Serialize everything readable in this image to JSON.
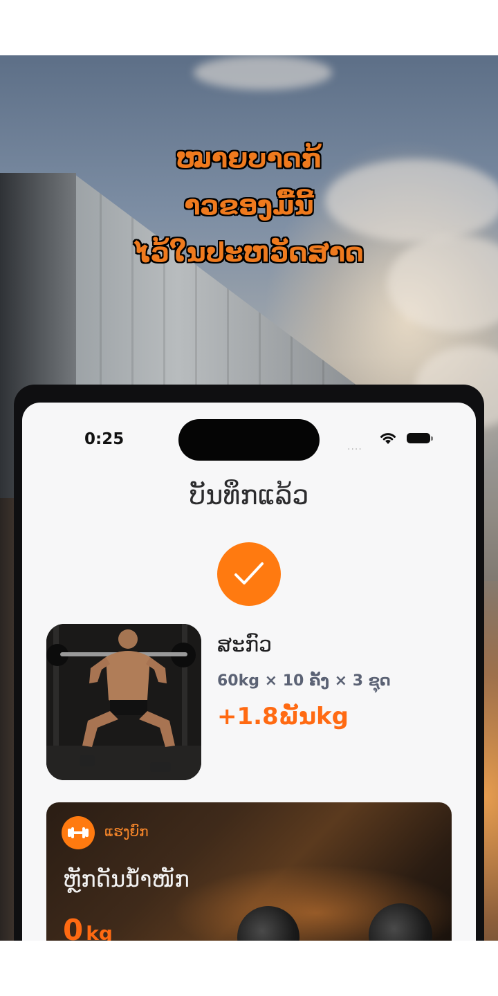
{
  "headline": {
    "lines": [
      "ໝາຍບາດກ້າວຂອງມື້ນີ້",
      "ໄວ້ໃນປະຫວັດສາດ"
    ],
    "line1": "ໝາຍບາດກ້",
    "line2": "າວຂອງມື້ນີ້",
    "line3": "ໄວ້ໃນປະຫວັດສາດ",
    "color": "#ef7a1e"
  },
  "status_bar": {
    "time": "0:25",
    "signal": "....",
    "icons": [
      "wifi-icon",
      "battery-icon"
    ]
  },
  "screen": {
    "title": "ບັນທຶກແລ້ວ",
    "status_icon": "check-icon",
    "accent_color": "#ff7a10"
  },
  "exercise": {
    "name": "ສະກົວ",
    "detail": "60kg × 10 ຄັ້ງ × 3 ຊຸດ",
    "volume": "+1.8ພັນkg",
    "image_icon": "squat-photo"
  },
  "lift_card": {
    "tag": "ແຮງຍົກ",
    "tag_icon": "dumbbell-icon",
    "title": "ຫຼັກດັນນ້ຳໜັກ",
    "value": "0",
    "unit": "kg"
  }
}
